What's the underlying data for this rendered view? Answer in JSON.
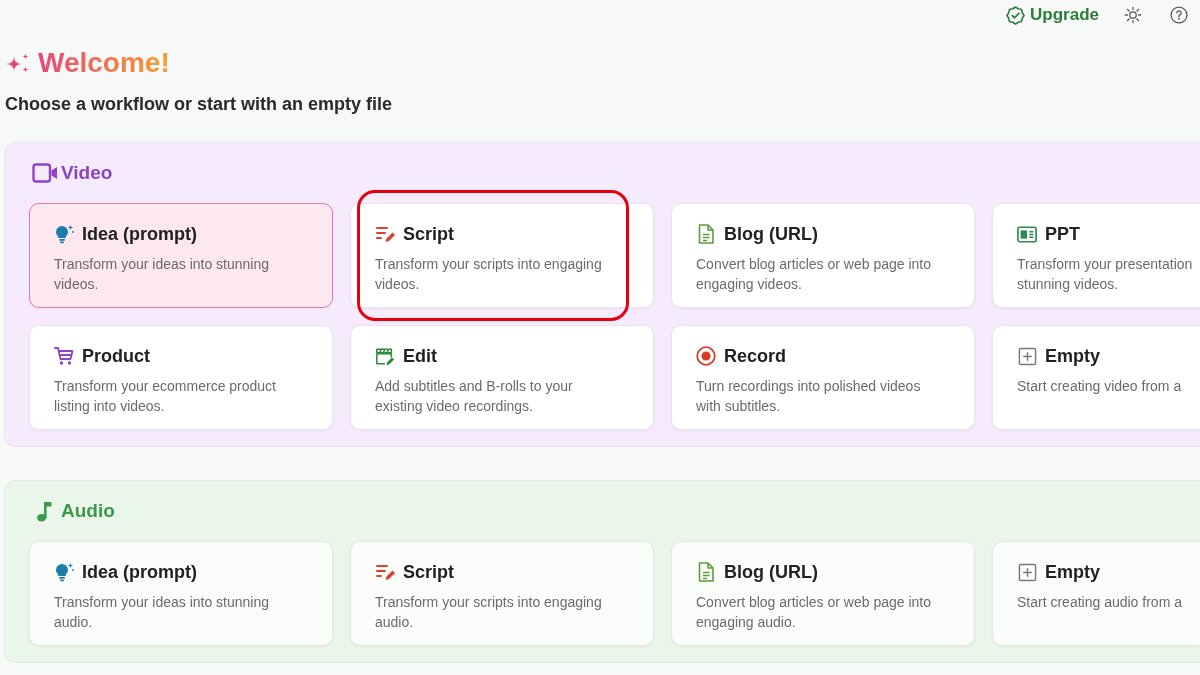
{
  "top_bar": {
    "upgrade": "Upgrade"
  },
  "welcome": {
    "title": "Welcome!",
    "subtitle": "Choose a workflow or start with an empty file"
  },
  "sections": [
    {
      "kind": "video",
      "title": "Video",
      "cards": [
        {
          "kind": "idea",
          "title": "Idea (prompt)",
          "description": "Transform your ideas into stunning videos.",
          "selected": true,
          "highlighted": false
        },
        {
          "kind": "script",
          "title": "Script",
          "description": "Transform your scripts into engaging videos.",
          "selected": false,
          "highlighted": true
        },
        {
          "kind": "blog",
          "title": "Blog (URL)",
          "description": "Convert blog articles or web page into engaging videos.",
          "selected": false,
          "highlighted": false
        },
        {
          "kind": "ppt",
          "title": "PPT",
          "description": "Transform your presentation stunning videos.",
          "selected": false,
          "highlighted": false
        },
        {
          "kind": "product",
          "title": "Product",
          "description": "Transform your ecommerce product listing into videos.",
          "selected": false,
          "highlighted": false
        },
        {
          "kind": "edit",
          "title": "Edit",
          "description": "Add subtitles and B-rolls to your existing video recordings.",
          "selected": false,
          "highlighted": false
        },
        {
          "kind": "record",
          "title": "Record",
          "description": "Turn recordings into polished videos with subtitles.",
          "selected": false,
          "highlighted": false
        },
        {
          "kind": "empty",
          "title": "Empty",
          "description": "Start creating video from a",
          "selected": false,
          "highlighted": false
        }
      ]
    },
    {
      "kind": "audio",
      "title": "Audio",
      "cards": [
        {
          "kind": "idea",
          "title": "Idea (prompt)",
          "description": "Transform your ideas into stunning audio.",
          "selected": false,
          "highlighted": false
        },
        {
          "kind": "script",
          "title": "Script",
          "description": "Transform your scripts into engaging audio.",
          "selected": false,
          "highlighted": false
        },
        {
          "kind": "blog",
          "title": "Blog (URL)",
          "description": "Convert blog articles or web page into engaging audio.",
          "selected": false,
          "highlighted": false
        },
        {
          "kind": "empty",
          "title": "Empty",
          "description": "Start creating audio from a",
          "selected": false,
          "highlighted": false
        }
      ]
    }
  ]
}
